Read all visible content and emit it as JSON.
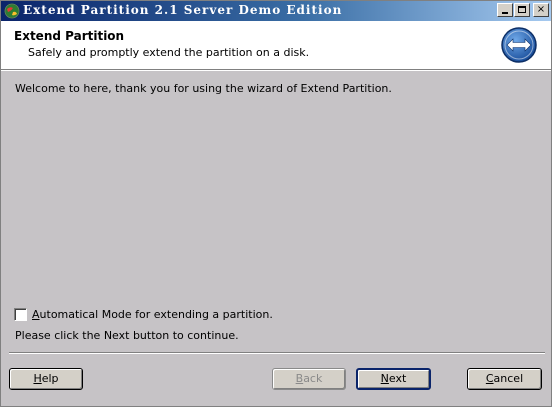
{
  "window": {
    "title": "Extend Partition 2.1 Server Demo Edition",
    "controls": {
      "close_label": "×"
    }
  },
  "header": {
    "title": "Extend Partition",
    "subtitle": "Safely and promptly extend the partition on a disk."
  },
  "main": {
    "welcome_text": "Welcome to here, thank you for using the wizard of Extend Partition.",
    "auto_mode_checkbox": {
      "label_mnemonic": "A",
      "label_rest": "utomatical Mode for extending a partition.",
      "checked": false
    },
    "instruction_text": "Please click the Next button to continue."
  },
  "footer": {
    "help": {
      "mnemonic": "H",
      "rest": "elp"
    },
    "back": {
      "mnemonic": "B",
      "rest": "ack"
    },
    "next": {
      "mnemonic": "N",
      "rest": "ext"
    },
    "cancel": {
      "mnemonic": "C",
      "rest": "ancel"
    }
  },
  "colors": {
    "title_gradient_start": "#0a246a",
    "title_gradient_end": "#a6caf0",
    "header_background": "#ffffff",
    "body_background": "#c6c3c6",
    "disabled_text": "#8a8a8a"
  },
  "icons": {
    "app_icon": "globe-icon",
    "header_icon": "double-arrow-icon"
  }
}
